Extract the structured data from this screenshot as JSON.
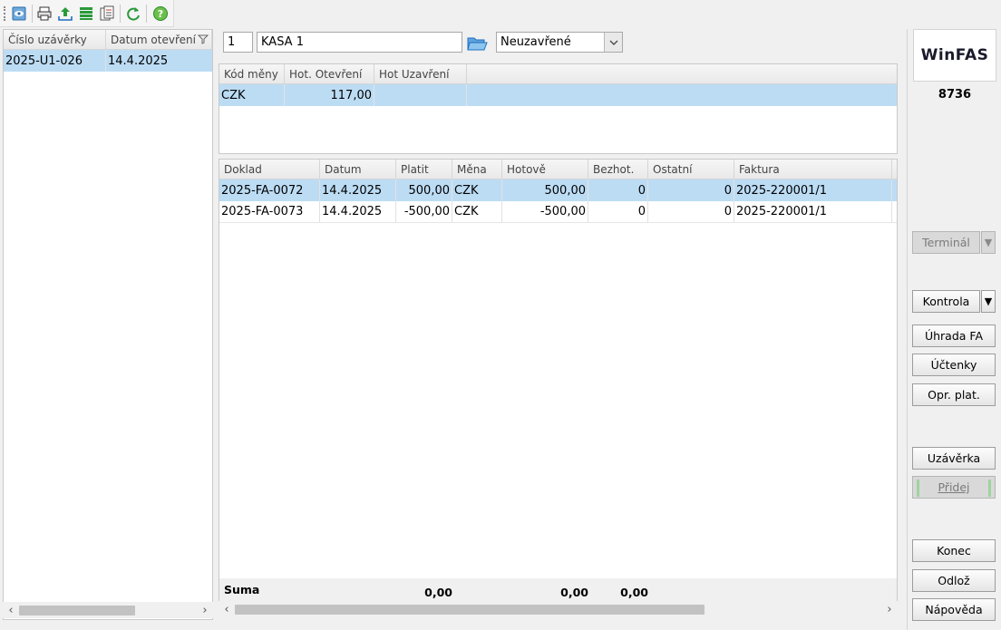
{
  "toolbar": {
    "icons": [
      "view-icon",
      "print-icon",
      "export-icon",
      "list-icon",
      "document-icon",
      "refresh-icon",
      "help-icon"
    ]
  },
  "left_grid": {
    "columns": [
      "Číslo uzávěrky",
      "Datum otevření"
    ],
    "rows": [
      {
        "cislo": "2025-U1-026",
        "datum": "14.4.2025"
      }
    ]
  },
  "header": {
    "kasa_number": "1",
    "kasa_name": "KASA 1",
    "status_select": "Neuzavřené"
  },
  "currency_grid": {
    "columns": [
      "Kód měny",
      "Hot. Otevření",
      "Hot Uzavření"
    ],
    "rows": [
      {
        "kod": "CZK",
        "otevreni": "117,00",
        "uzavreni": ""
      }
    ]
  },
  "documents_grid": {
    "columns": [
      "Doklad",
      "Datum",
      "Platit",
      "Měna",
      "Hotově",
      "Bezhot.",
      "Ostatní",
      "Faktura"
    ],
    "rows": [
      {
        "doklad": "2025-FA-0072",
        "datum": "14.4.2025",
        "platit": "500,00",
        "mena": "CZK",
        "hotove": "500,00",
        "bezhot": "0",
        "ostatni": "0",
        "faktura": "2025-220001/1"
      },
      {
        "doklad": "2025-FA-0073",
        "datum": "14.4.2025",
        "platit": "-500,00",
        "mena": "CZK",
        "hotove": "-500,00",
        "bezhot": "0",
        "ostatni": "0",
        "faktura": "2025-220001/1"
      }
    ],
    "summary": {
      "label": "Suma",
      "platit": "0,00",
      "hotove": "0,00",
      "bezhot": "0,00"
    }
  },
  "right_panel": {
    "logo": "WinFAS",
    "code": "8736",
    "buttons": {
      "terminal": "Terminál",
      "kontrola": "Kontrola",
      "uhrada": "Úhrada FA",
      "uctenky": "Účtenky",
      "opr_plat": "Opr. plat.",
      "uzaverka": "Uzávěrka",
      "pridej": "Přidej",
      "konec": "Konec",
      "odloz": "Odlož",
      "napoveda": "Nápověda"
    }
  },
  "colors": {
    "selection": "#bcdcf4",
    "accent_green": "#2a9a3a",
    "accent_blue": "#1e6fbf"
  }
}
